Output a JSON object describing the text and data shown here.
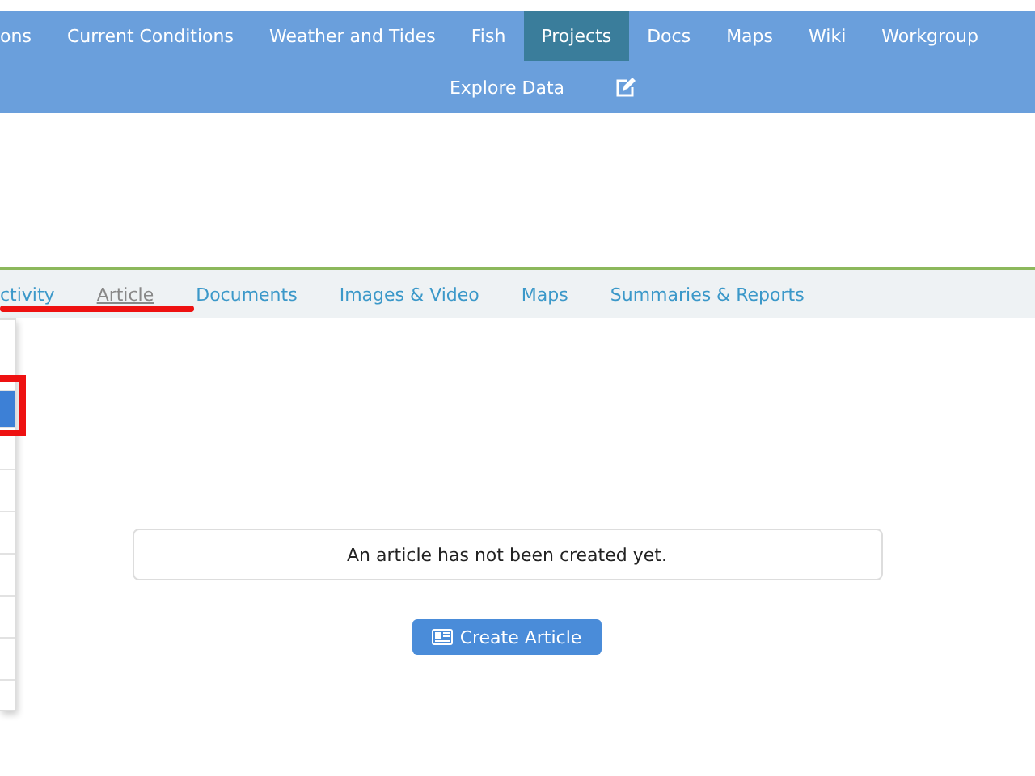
{
  "nav": {
    "items": [
      {
        "label": "ons",
        "selected": false
      },
      {
        "label": "Current Conditions",
        "selected": false
      },
      {
        "label": "Weather and Tides",
        "selected": false
      },
      {
        "label": "Fish",
        "selected": false
      },
      {
        "label": "Projects",
        "selected": true
      },
      {
        "label": "Docs",
        "selected": false
      },
      {
        "label": "Maps",
        "selected": false
      },
      {
        "label": "Wiki",
        "selected": false
      },
      {
        "label": "Workgroup",
        "selected": false
      }
    ],
    "second_row": {
      "label": "Explore Data"
    }
  },
  "tabs": [
    {
      "label": "ctivity",
      "selected": false
    },
    {
      "label": "Article",
      "selected": true
    },
    {
      "label": "Documents",
      "selected": false
    },
    {
      "label": "Images & Video",
      "selected": false
    },
    {
      "label": "Maps",
      "selected": false
    },
    {
      "label": "Summaries & Reports",
      "selected": false
    }
  ],
  "dropdown": {
    "rows": [
      {
        "selected": false
      },
      {
        "selected": true
      },
      {
        "selected": false
      },
      {
        "selected": false
      },
      {
        "selected": false
      },
      {
        "selected": false
      },
      {
        "selected": false
      },
      {
        "selected": false
      }
    ]
  },
  "article": {
    "message": "An article has not been created yet.",
    "button": "Create Article"
  }
}
